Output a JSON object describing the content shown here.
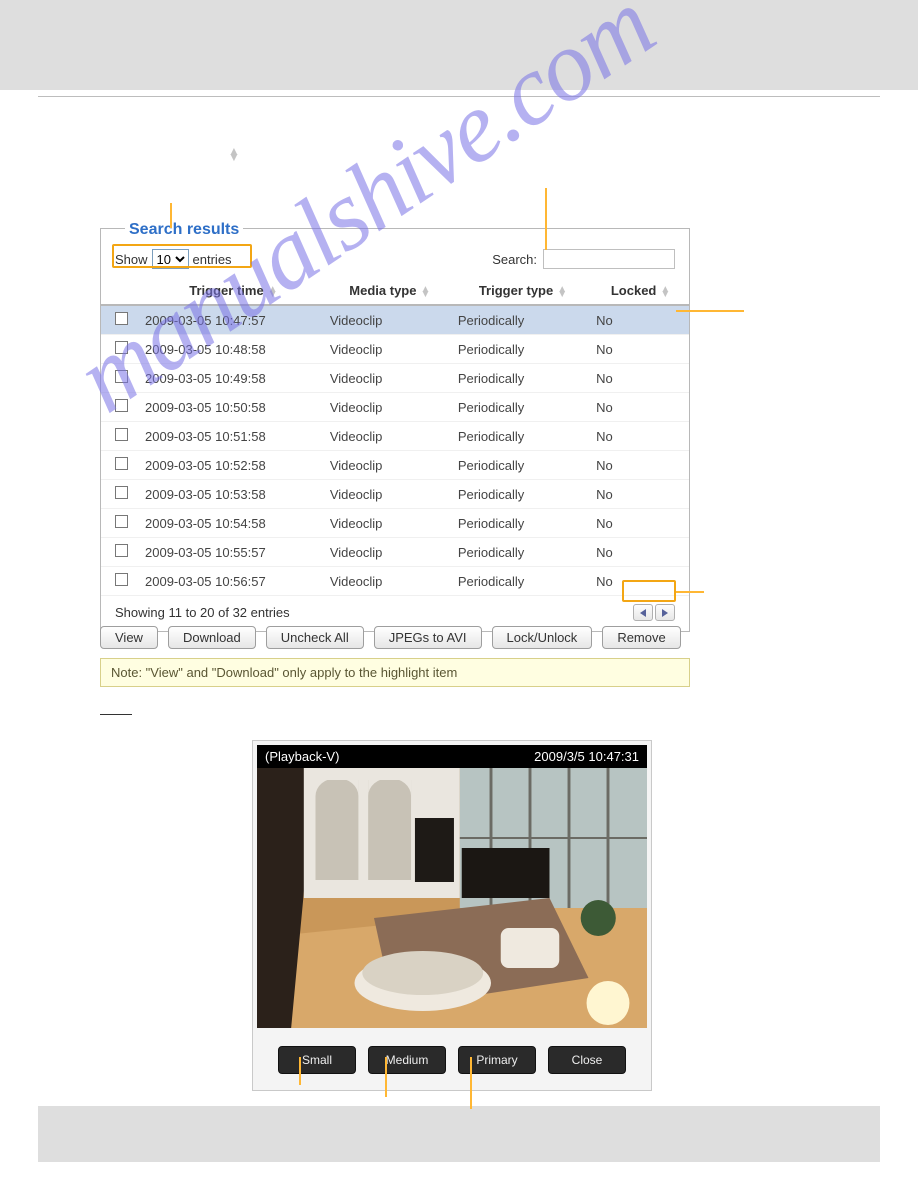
{
  "watermark": "manualshive.com",
  "panel": {
    "legend": "Search results",
    "show_label_prefix": "Show",
    "show_value": "10",
    "show_label_suffix": "entries",
    "search_label": "Search:",
    "columns": {
      "trigger_time": "Trigger time",
      "media_type": "Media type",
      "trigger_type": "Trigger type",
      "locked": "Locked"
    },
    "rows": [
      {
        "trigger_time": "2009-03-05 10:47:57",
        "media_type": "Videoclip",
        "trigger_type": "Periodically",
        "locked": "No",
        "selected": true
      },
      {
        "trigger_time": "2009-03-05 10:48:58",
        "media_type": "Videoclip",
        "trigger_type": "Periodically",
        "locked": "No"
      },
      {
        "trigger_time": "2009-03-05 10:49:58",
        "media_type": "Videoclip",
        "trigger_type": "Periodically",
        "locked": "No"
      },
      {
        "trigger_time": "2009-03-05 10:50:58",
        "media_type": "Videoclip",
        "trigger_type": "Periodically",
        "locked": "No"
      },
      {
        "trigger_time": "2009-03-05 10:51:58",
        "media_type": "Videoclip",
        "trigger_type": "Periodically",
        "locked": "No"
      },
      {
        "trigger_time": "2009-03-05 10:52:58",
        "media_type": "Videoclip",
        "trigger_type": "Periodically",
        "locked": "No"
      },
      {
        "trigger_time": "2009-03-05 10:53:58",
        "media_type": "Videoclip",
        "trigger_type": "Periodically",
        "locked": "No"
      },
      {
        "trigger_time": "2009-03-05 10:54:58",
        "media_type": "Videoclip",
        "trigger_type": "Periodically",
        "locked": "No"
      },
      {
        "trigger_time": "2009-03-05 10:55:57",
        "media_type": "Videoclip",
        "trigger_type": "Periodically",
        "locked": "No"
      },
      {
        "trigger_time": "2009-03-05 10:56:57",
        "media_type": "Videoclip",
        "trigger_type": "Periodically",
        "locked": "No"
      }
    ],
    "status_text": "Showing 11 to 20 of 32 entries"
  },
  "buttons": {
    "view": "View",
    "download": "Download",
    "uncheck_all": "Uncheck All",
    "jpegs_to_avi": "JPEGs to AVI",
    "lock_unlock": "Lock/Unlock",
    "remove": "Remove"
  },
  "note": "Note: \"View\" and \"Download\" only apply to the highlight item",
  "viewer": {
    "title_left": "(Playback-V)",
    "title_right": "2009/3/5 10:47:31",
    "btn_small": "Small",
    "btn_medium": "Medium",
    "btn_primary": "Primary",
    "btn_close": "Close"
  },
  "colors": {
    "accent_orange": "#f3a614",
    "link_blue": "#2e6fc7",
    "selected_row": "#cbd9ec",
    "note_bg": "#fffee1"
  }
}
